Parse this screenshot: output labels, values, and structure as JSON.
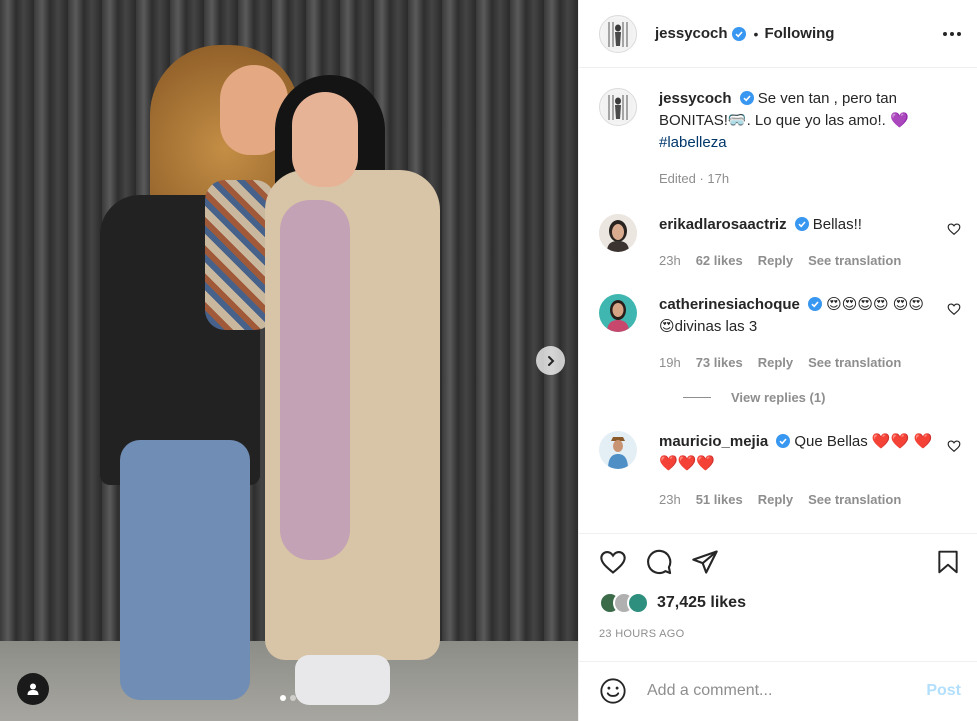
{
  "header": {
    "username": "jessycoch",
    "verified": true,
    "separator": "•",
    "follow_status": "Following"
  },
  "caption": {
    "username": "jessycoch",
    "text": "Se ven tan , pero tan BONITAS!🥽. Lo que yo las amo!. 💜",
    "hashtag": "#labelleza",
    "timestamp": "Edited · 17h"
  },
  "comments": [
    {
      "username": "erikadlarosaactriz",
      "verified": true,
      "text": "Bellas!!",
      "time": "23h",
      "likes": "62 likes",
      "reply": "Reply",
      "translate": "See translation"
    },
    {
      "username": "catherinesiachoque",
      "verified": true,
      "text": "😍😍😍😍 😍😍😍divinas las 3",
      "time": "19h",
      "likes": "73 likes",
      "reply": "Reply",
      "translate": "See translation",
      "view_replies": "View replies (1)"
    },
    {
      "username": "mauricio_mejia",
      "verified": true,
      "text": "Que Bellas ❤️❤️ ❤️❤️❤️❤️",
      "time": "23h",
      "likes": "51 likes",
      "reply": "Reply",
      "translate": "See translation"
    }
  ],
  "actions": {
    "likes_count": "37,425 likes",
    "time_ago": "23 HOURS AGO"
  },
  "add_comment": {
    "placeholder": "Add a comment...",
    "post_label": "Post"
  },
  "carousel": {
    "slide_count": 2,
    "active_index": 0
  },
  "colors": {
    "verified_blue": "#3897f0",
    "link_blue": "#00376b",
    "post_button_disabled": "#b2dffc",
    "secondary_text": "#8e8e8e"
  },
  "icons": [
    "chevron-right-icon",
    "user-tag-icon",
    "more-icon",
    "heart-icon",
    "comment-icon",
    "share-icon",
    "bookmark-icon",
    "emoji-icon",
    "verified-badge-icon"
  ]
}
